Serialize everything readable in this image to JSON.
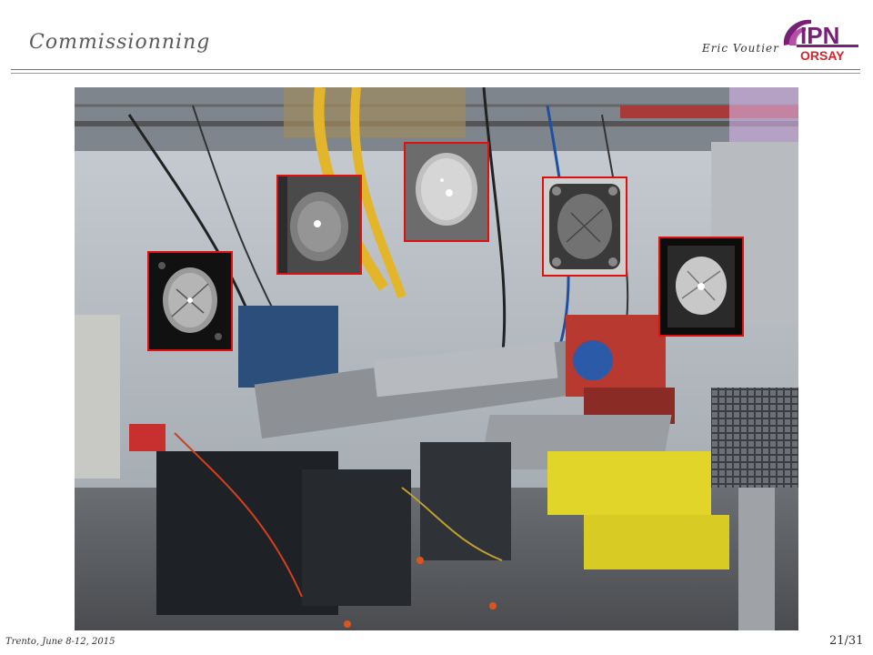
{
  "slide": {
    "title": "Commissionning",
    "author": "Eric Voutier",
    "logo": {
      "line1": "IPN",
      "line2": "ORSAY"
    },
    "footer": "Trento, June 8-12, 2015",
    "page": "21/31"
  },
  "colors": {
    "title": "#5a5a5a",
    "rule": "#777777",
    "inset_border": "#e01010",
    "logo_purple": "#7a1f78",
    "logo_red": "#d8242a"
  },
  "icons": [
    "ipn-orsay-logo"
  ]
}
